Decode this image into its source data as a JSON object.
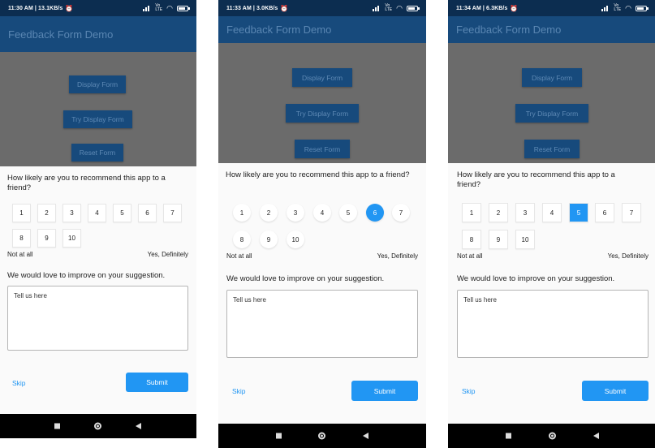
{
  "screens": [
    {
      "status": "11:30 AM | 13.1KB/s",
      "app_title": "Feedback Form Demo",
      "buttons": [
        "Display Form",
        "Try Display Form",
        "Reset Form"
      ],
      "question": "How likely are you to recommend this app to a friend?",
      "ratings": [
        "1",
        "2",
        "3",
        "4",
        "5",
        "6",
        "7",
        "8",
        "9",
        "10"
      ],
      "selected_rating": null,
      "label_low": "Not at all",
      "label_high": "Yes, Definitely",
      "prompt": "We would love to improve on your suggestion.",
      "placeholder": "Tell us here",
      "skip": "Skip",
      "submit": "Submit"
    },
    {
      "status": "11:33 AM | 3.0KB/s",
      "app_title": "Feedback Form Demo",
      "buttons": [
        "Display Form",
        "Try Display Form",
        "Reset Form"
      ],
      "question": "How likely are you to recommend this app to a friend?",
      "ratings": [
        "1",
        "2",
        "3",
        "4",
        "5",
        "6",
        "7",
        "8",
        "9",
        "10"
      ],
      "selected_rating": "6",
      "label_low": "Not at all",
      "label_high": "Yes, Definitely",
      "prompt": "We would love to improve on your suggestion.",
      "placeholder": "Tell us here",
      "skip": "Skip",
      "submit": "Submit"
    },
    {
      "status": "11:34 AM | 6.3KB/s",
      "app_title": "Feedback Form Demo",
      "buttons": [
        "Display Form",
        "Try Display Form",
        "Reset Form"
      ],
      "question": "How likely are you to recommend this app to a friend?",
      "ratings": [
        "1",
        "2",
        "3",
        "4",
        "5",
        "6",
        "7",
        "8",
        "9",
        "10"
      ],
      "selected_rating": "5",
      "label_low": "Not at all",
      "label_high": "Yes, Definitely",
      "prompt": "We would love to improve on your suggestion.",
      "placeholder": "Tell us here",
      "skip": "Skip",
      "submit": "Submit"
    }
  ],
  "colors": {
    "status_bar": "#0c2d50",
    "app_bar": "#174a7c",
    "accent": "#2196f3",
    "overlay": "#6b6b6b"
  },
  "icons": {
    "status": [
      "alarm-icon",
      "signal-icon",
      "volte-icon",
      "wifi-icon",
      "battery-icon"
    ],
    "nav": [
      "recents-square-icon",
      "home-circle-icon",
      "back-triangle-icon"
    ]
  }
}
